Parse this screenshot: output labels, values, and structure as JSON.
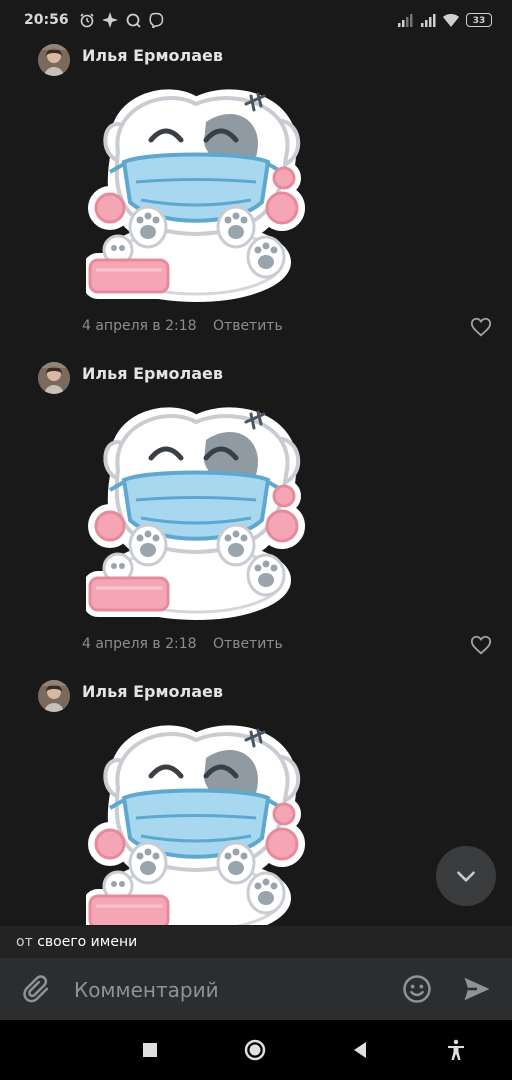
{
  "status_bar": {
    "time": "20:56",
    "battery": "33",
    "icons": [
      "alarm-icon",
      "sparkle-icon",
      "refresh-icon",
      "viber-icon",
      "signal-icon",
      "signal-icon",
      "wifi-icon",
      "battery-icon"
    ]
  },
  "comments": [
    {
      "author": "Илья Ермолаев",
      "date": "4 апреля в 2:18",
      "reply_label": "Ответить",
      "content": "sticker"
    },
    {
      "author": "Илья Ермолаев",
      "date": "4 апреля в 2:18",
      "reply_label": "Ответить",
      "content": "sticker"
    },
    {
      "author": "Илья Ермолаев",
      "content": "sticker"
    }
  ],
  "from_strip": {
    "prefix": "от",
    "name": "своего имени"
  },
  "composer": {
    "placeholder": "Комментарий",
    "value": ""
  },
  "colors": {
    "background": "#19191a",
    "composer_bg": "#2c2d2e",
    "meta_text": "#8b8d91",
    "sticker_mask": "#a8d8f0",
    "sticker_pink": "#f4a6b4"
  }
}
